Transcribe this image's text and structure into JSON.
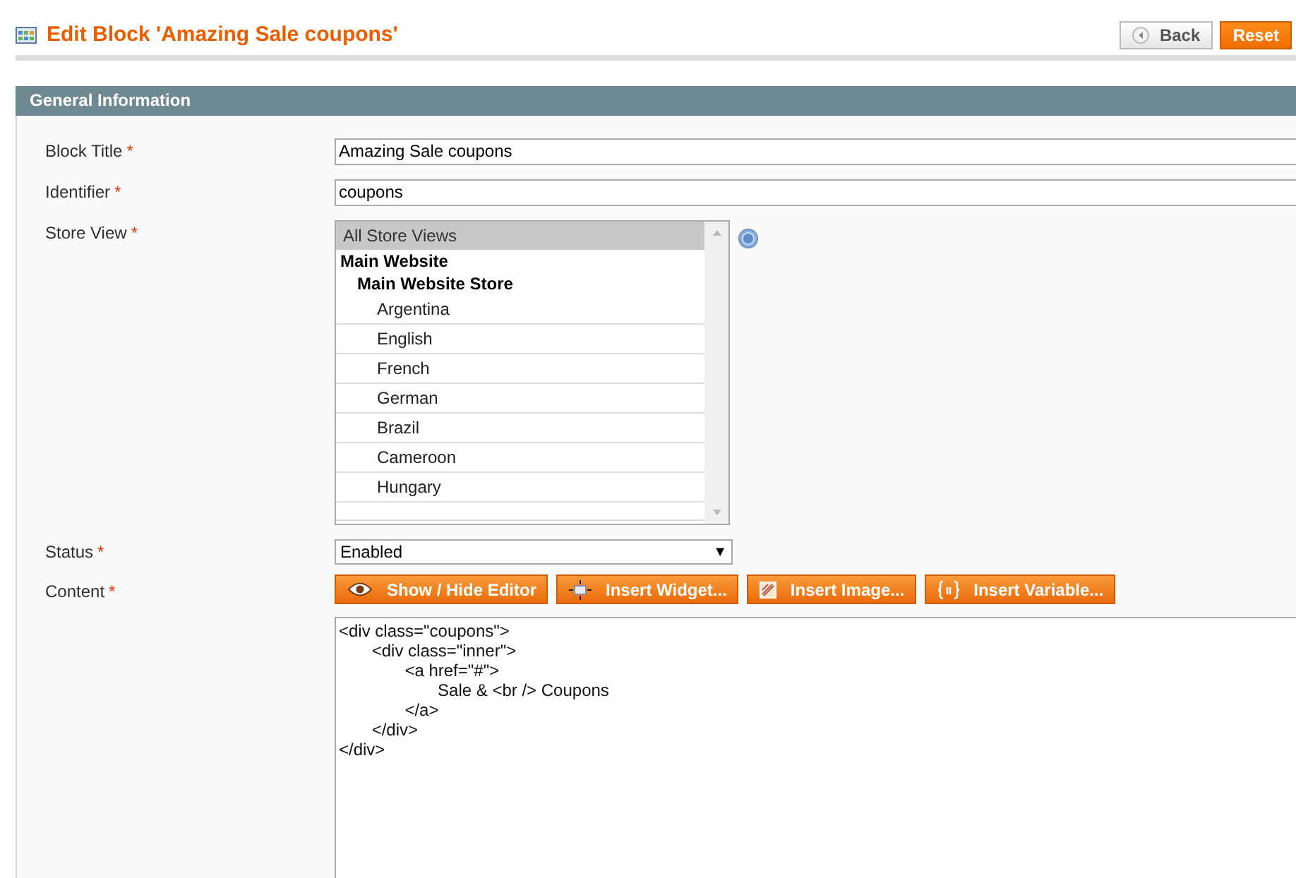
{
  "page_title": "Edit Block 'Amazing Sale coupons'",
  "header_buttons": [
    {
      "label": "Back",
      "kind": "back"
    },
    {
      "label": "Reset",
      "kind": "primary"
    }
  ],
  "section": {
    "title": "General Information"
  },
  "fields": [
    {
      "label": "Block Title",
      "required_mark": "*",
      "kind": "text",
      "value": "Amazing Sale coupons"
    },
    {
      "label": "Identifier",
      "required_mark": "*",
      "kind": "text",
      "value": "coupons"
    },
    {
      "label": "Store View",
      "required_mark": "*",
      "kind": "multiselect",
      "options": [
        {
          "label": "All Store Views",
          "selected": true
        },
        {
          "label": "Main Website",
          "kind": "group",
          "children": [
            {
              "label": "Main Website Store",
              "kind": "group",
              "children": [
                {
                  "label": "Argentina",
                  "selected": false
                },
                {
                  "label": "English",
                  "selected": false
                },
                {
                  "label": "French",
                  "selected": false
                },
                {
                  "label": "German",
                  "selected": false
                },
                {
                  "label": "Brazil",
                  "selected": false
                },
                {
                  "label": "Cameroon",
                  "selected": false
                },
                {
                  "label": "Hungary",
                  "selected": false
                }
              ]
            }
          ]
        }
      ]
    },
    {
      "label": "Status",
      "required_mark": "*",
      "kind": "select",
      "value": "Enabled",
      "arrow": "▼"
    },
    {
      "label": "Content",
      "required_mark": "*",
      "kind": "editor",
      "buttons": [
        {
          "label": "Show / Hide Editor"
        },
        {
          "label": "Insert Widget..."
        },
        {
          "label": "Insert Image..."
        },
        {
          "label": "Insert Variable..."
        }
      ],
      "value": "<div class=\"coupons\">\n\t<div class=\"inner\">\n\t\t<a href=\"#\">\n\t\t\tSale & <br /> Coupons\n\t\t</a>\n\t</div>\n</div>"
    }
  ]
}
